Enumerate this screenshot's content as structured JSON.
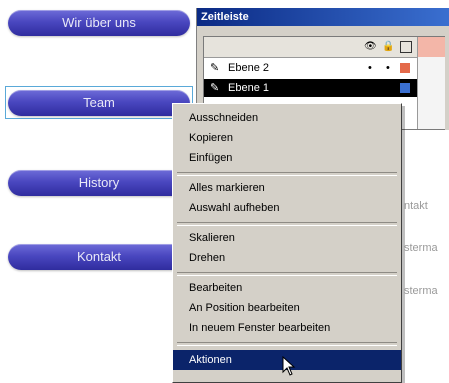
{
  "nav": {
    "buttons": [
      {
        "label": "Wir über uns"
      },
      {
        "label": "Team"
      },
      {
        "label": "History"
      },
      {
        "label": "Kontakt"
      }
    ]
  },
  "timeline": {
    "title": "Zeitleiste",
    "layers": [
      {
        "name": "Ebene 2"
      },
      {
        "name": "Ebene 1"
      }
    ]
  },
  "context_menu": {
    "items": [
      {
        "label": "Ausschneiden"
      },
      {
        "label": "Kopieren"
      },
      {
        "label": "Einfügen"
      },
      {
        "label": "Alles markieren"
      },
      {
        "label": "Auswahl aufheben"
      },
      {
        "label": "Skalieren"
      },
      {
        "label": "Drehen"
      },
      {
        "label": "Bearbeiten"
      },
      {
        "label": "An Position bearbeiten"
      },
      {
        "label": "In neuem Fenster bearbeiten"
      },
      {
        "label": "Aktionen"
      }
    ]
  },
  "background": {
    "text1": "ntakt",
    "text2": "sterma",
    "text3": "sterma"
  },
  "colors": {
    "pill": "#4a47c0",
    "menu_highlight": "#0b246a",
    "panel_bg": "#d4d0c8",
    "title_bar": "#0b2a84"
  }
}
